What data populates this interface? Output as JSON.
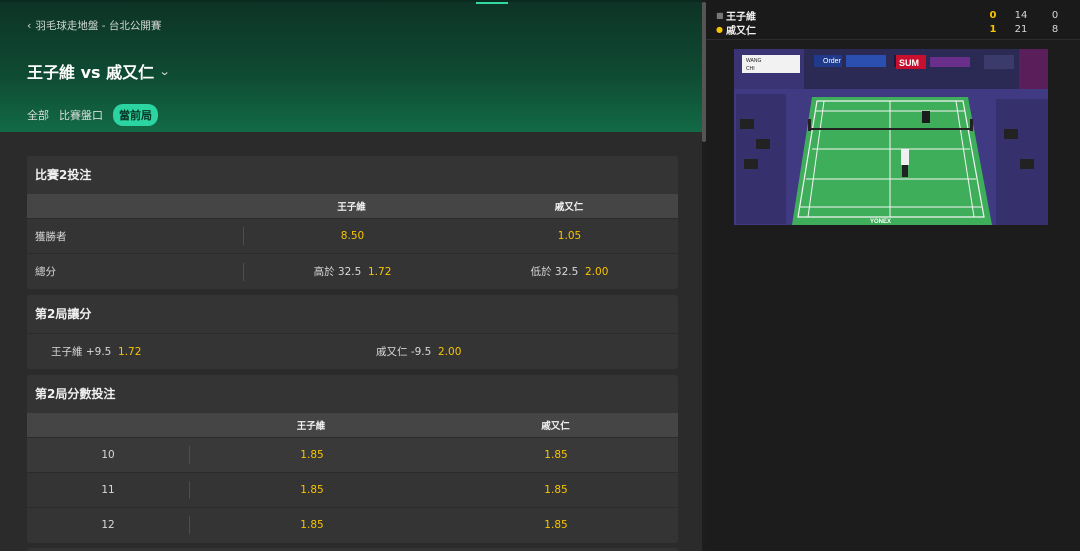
{
  "breadcrumb": {
    "text": "羽毛球走地盤 - 台北公開賽"
  },
  "match": {
    "title": "王子維 vs 戚又仁"
  },
  "tabs": [
    {
      "label": "全部",
      "active": false
    },
    {
      "label": "比賽盤口",
      "active": false
    },
    {
      "label": "當前局",
      "active": true
    }
  ],
  "markets": {
    "match2": {
      "title": "比賽2投注",
      "header": {
        "p1": "王子維",
        "p2": "戚又仁"
      },
      "rows": [
        {
          "label": "獲勝者",
          "p1_odds": "8.50",
          "p2_odds": "1.05"
        },
        {
          "label": "總分",
          "p1_prefix": "高於 32.5",
          "p1_odds": "1.72",
          "p2_prefix": "低於 32.5",
          "p2_odds": "2.00"
        }
      ]
    },
    "game2_handicap": {
      "title": "第2局讓分",
      "p1_label": "王子維 +9.5",
      "p1_odds": "1.72",
      "p2_label": "戚又仁 -9.5",
      "p2_odds": "2.00"
    },
    "game2_points": {
      "title": "第2局分數投注",
      "header": {
        "p1": "王子維",
        "p2": "戚又仁"
      },
      "rows": [
        {
          "label": "10",
          "p1_odds": "1.85",
          "p2_odds": "1.85"
        },
        {
          "label": "11",
          "p1_odds": "1.85",
          "p2_odds": "1.85"
        },
        {
          "label": "12",
          "p1_odds": "1.85",
          "p2_odds": "1.85"
        }
      ]
    }
  },
  "scoreboard": {
    "players": [
      {
        "name": "王子維",
        "games": "0",
        "game1": "14",
        "game2": "0",
        "serving": false
      },
      {
        "name": "戚又仁",
        "games": "1",
        "game1": "21",
        "game2": "8",
        "serving": true
      }
    ]
  },
  "video": {
    "overlay_names": [
      "WANG",
      "CHI"
    ],
    "sponsor": "SUM",
    "brand": "YONEX",
    "overlay_text": "Order",
    "court_color": "#3fae5a",
    "crowd_color": "#3a3475"
  },
  "colors": {
    "accent": "#2bd4a0",
    "odds": "#f7c400"
  }
}
